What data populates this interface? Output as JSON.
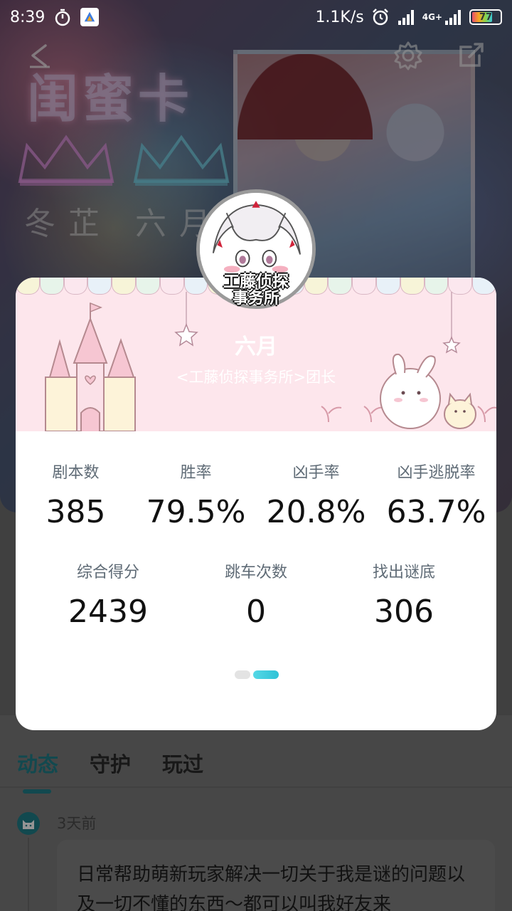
{
  "status_bar": {
    "time": "8:39",
    "net_speed": "1.1K/s",
    "network_type": "4G+",
    "battery": "77",
    "icons": [
      "stopwatch-icon",
      "app-badge-icon",
      "alarm-icon",
      "signal-icon",
      "signal-4g-icon",
      "battery-icon"
    ]
  },
  "hero": {
    "title": "闺蜜卡",
    "names": "冬芷 六月"
  },
  "profile": {
    "name": "六月",
    "subtitle": "<工藤侦探事务所>团长",
    "badge_line1": "工藤侦探",
    "badge_line2": "事务所"
  },
  "stats_row1": [
    {
      "label": "剧本数",
      "value": "385"
    },
    {
      "label": "胜率",
      "value": "79.5%"
    },
    {
      "label": "凶手率",
      "value": "20.8%"
    },
    {
      "label": "凶手逃脱率",
      "value": "63.7%"
    }
  ],
  "stats_row2": [
    {
      "label": "综合得分",
      "value": "2439"
    },
    {
      "label": "跳车次数",
      "value": "0"
    },
    {
      "label": "找出谜底",
      "value": "306"
    }
  ],
  "pager": {
    "active_index": 1,
    "count": 2
  },
  "tabs": [
    {
      "label": "动态",
      "active": true
    },
    {
      "label": "守护",
      "active": false
    },
    {
      "label": "玩过",
      "active": false
    }
  ],
  "post": {
    "time": "3天前",
    "text": "日常帮助萌新玩家解决一切关于我是谜的问题以及一切不懂的东西～都可以叫我好友来"
  },
  "colors": {
    "accent": "#1f7e88",
    "pager_active": "#2fc2d6",
    "banner_bg": "#fde6ec"
  }
}
